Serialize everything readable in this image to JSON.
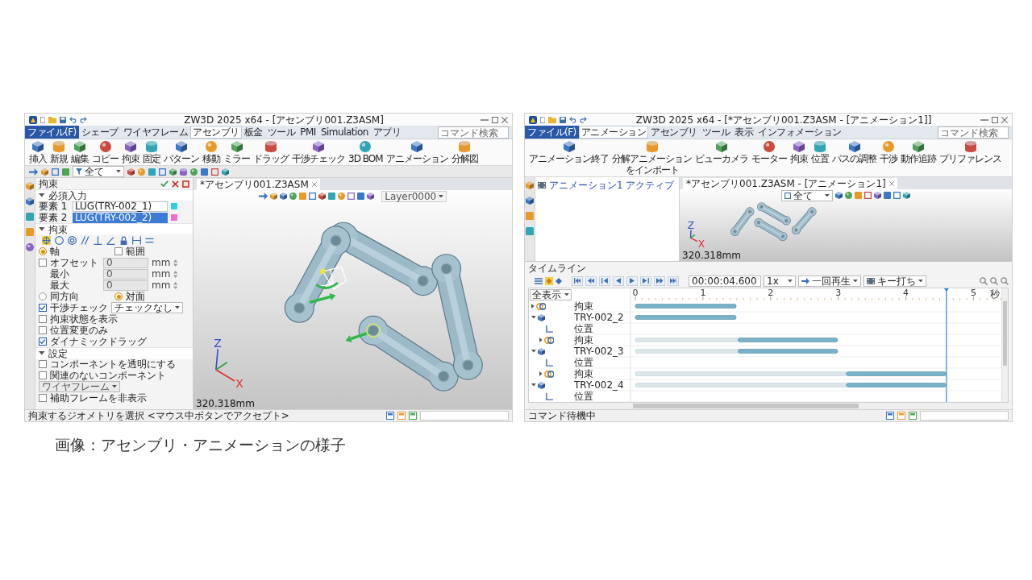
{
  "assembly_window": {
    "title_bar": {
      "title": "ZW3D 2025 x64 - [アセンブリ001.Z3ASM]"
    },
    "tabs": [
      {
        "label": "ファイル(F)",
        "kind": "file",
        "selected": false
      },
      {
        "label": "シェープ",
        "kind": "tab",
        "selected": false
      },
      {
        "label": "ワイヤフレーム",
        "kind": "tab",
        "selected": false
      },
      {
        "label": "アセンブリ",
        "kind": "tab",
        "selected": true
      },
      {
        "label": "板金",
        "kind": "tab",
        "selected": false
      },
      {
        "label": "ツール",
        "kind": "tab",
        "selected": false
      },
      {
        "label": "PMI",
        "kind": "tab",
        "selected": false
      },
      {
        "label": "Simulation",
        "kind": "tab",
        "selected": false
      },
      {
        "label": "アプリ",
        "kind": "tab",
        "selected": false
      }
    ],
    "search": {
      "placeholder": "コマンド検索"
    },
    "ribbon": [
      {
        "label": "挿入"
      },
      {
        "label": "新規"
      },
      {
        "label": "編集"
      },
      {
        "label": "コピー"
      },
      {
        "label": "拘束"
      },
      {
        "label": "固定"
      },
      {
        "label": "パターン"
      },
      {
        "label": "移動"
      },
      {
        "label": "ミラー"
      },
      {
        "label": "ドラッグ"
      },
      {
        "label": "干渉チェック"
      },
      {
        "label": "3D BOM"
      },
      {
        "label": "アニメーション"
      },
      {
        "label": "分解図"
      }
    ],
    "toolbar": {
      "filter": "全て"
    },
    "panel": {
      "title": "拘束",
      "sections": [
        {
          "title": "必須入力",
          "expanded": true,
          "rows": [
            {
              "kind": "field",
              "label": "要素 1",
              "value": "LUG(TRY-002_1)",
              "selected": false,
              "color": "#27d4e6"
            },
            {
              "kind": "field",
              "label": "要素 2",
              "value": "LUG(TRY-002_2)",
              "selected": true,
              "color": "#f06ccf"
            }
          ]
        },
        {
          "title": "拘束",
          "expanded": true,
          "rows": [
            {
              "kind": "icons",
              "items": [
                {
                  "selected": true
                },
                {
                  "selected": false
                },
                {
                  "selected": false
                },
                {
                  "selected": false
                },
                {
                  "selected": false
                },
                {
                  "selected": false
                },
                {
                  "selected": false
                },
                {
                  "selected": false
                },
                {
                  "selected": false
                }
              ]
            },
            {
              "kind": "options",
              "items": [
                {
                  "kind": "radio",
                  "label": "軸",
                  "selected": true
                },
                {
                  "kind": "check",
                  "label": "範囲",
                  "checked": false
                }
              ]
            },
            {
              "kind": "number",
              "label": "オフセット",
              "checked": false,
              "value": "0",
              "unit": "mm",
              "disabled": true
            },
            {
              "kind": "number",
              "label": "最小",
              "value": "0",
              "unit": "mm",
              "disabled": true
            },
            {
              "kind": "number",
              "label": "最大",
              "value": "0",
              "unit": "mm",
              "disabled": true
            },
            {
              "kind": "options",
              "items": [
                {
                  "kind": "radio",
                  "label": "同方向",
                  "selected": false
                },
                {
                  "kind": "radio",
                  "label": "対面",
                  "selected": true
                }
              ]
            },
            {
              "kind": "dropdown",
              "label": "干渉チェック",
              "checked": true,
              "value": "チェックなし",
              "disabled": false
            },
            {
              "kind": "check",
              "label": "拘束状態を表示",
              "checked": false
            },
            {
              "kind": "check",
              "label": "位置変更のみ",
              "checked": false
            },
            {
              "kind": "check",
              "label": "ダイナミックドラッグ",
              "checked": true
            }
          ]
        },
        {
          "title": "設定",
          "expanded": true,
          "rows": [
            {
              "kind": "check",
              "label": "コンポーネントを透明にする",
              "checked": false
            },
            {
              "kind": "dropdown",
              "label": "関連のないコンポーネント",
              "checked": false,
              "value": "ワイヤフレーム",
              "disabled": true
            },
            {
              "kind": "check",
              "label": "補助フレームを非表示",
              "checked": false
            }
          ]
        }
      ]
    },
    "document_tab": "*アセンブリ001.Z3ASM",
    "layer": "Layer0000",
    "axes": [
      "Z",
      "X"
    ],
    "scale": "320.318mm",
    "status_bar": "拘束するジオメトリを選択 <マウス中ボタンでアクセプト>"
  },
  "animation_window": {
    "title_bar": {
      "title": "ZW3D 2025 x64 - [*アセンブリ001.Z3ASM - [アニメーション1]]"
    },
    "tabs": [
      {
        "label": "ファイル(F)",
        "kind": "file",
        "selected": false
      },
      {
        "label": "アニメーション",
        "kind": "tab",
        "selected": true
      },
      {
        "label": "アセンブリ",
        "kind": "tab",
        "selected": false
      },
      {
        "label": "ツール",
        "kind": "tab",
        "selected": false
      },
      {
        "label": "表示",
        "kind": "tab",
        "selected": false
      },
      {
        "label": "インフォメーション",
        "kind": "tab",
        "selected": false
      }
    ],
    "search": {
      "placeholder": "コマンド検索"
    },
    "ribbon": [
      {
        "label": "アニメーション終了"
      },
      {
        "label": "分解アニメーションをインポート"
      },
      {
        "label": "ビューカメラ"
      },
      {
        "label": "モーター"
      },
      {
        "label": "拘束"
      },
      {
        "label": "位置"
      },
      {
        "label": "パスの調整"
      },
      {
        "label": "干渉"
      },
      {
        "label": "動作追跡"
      },
      {
        "label": "プリファレンス"
      }
    ],
    "manager": {
      "items": [
        {
          "label": "アニメーション1 アクティブ",
          "selected": false
        }
      ]
    },
    "document_tab": "*アセンブリ001.Z3ASM - [アニメーション1]",
    "view_filter": "全て",
    "axes": [
      "Z",
      "X"
    ],
    "scale": "320.318mm",
    "timeline": {
      "title": "タイムライン",
      "time": "00:00:04.600",
      "speed": "1x",
      "play_mode": "一回再生",
      "key_mode": "キー打ち",
      "filter": "全表示",
      "tree": [
        {
          "kind": "constraint",
          "expanded": false
        },
        {
          "kind": "component",
          "expanded": true,
          "children": [
            {
              "kind": "position"
            },
            {
              "kind": "constraint",
              "expanded": false
            }
          ]
        },
        {
          "kind": "component",
          "expanded": true,
          "children": [
            {
              "kind": "position"
            },
            {
              "kind": "constraint",
              "expanded": false
            }
          ]
        },
        {
          "kind": "component",
          "expanded": true,
          "children": [
            {
              "kind": "position"
            }
          ]
        }
      ],
      "chart_data": {
        "type": "bar",
        "orientation": "horizontal",
        "stacked": true,
        "categories": [
          "拘束",
          "TRY-002_2",
          "位置",
          "拘束",
          "TRY-002_3",
          "位置",
          "拘束",
          "TRY-002_4",
          "位置"
        ],
        "xlabel": "秒",
        "xlim": [
          0,
          5.4
        ],
        "xticks": [
          0,
          1,
          2,
          3,
          4,
          5
        ],
        "series": [
          {
            "color": "#dbe5ea",
            "values": [
              null,
              null,
              null,
              1.52,
              1.52,
              null,
              3.12,
              3.12,
              null
            ]
          },
          {
            "color": "#78b2c6",
            "values": [
              1.49,
              1.49,
              null,
              1.47,
              1.47,
              null,
              1.47,
              1.47,
              null
            ]
          }
        ],
        "ref_lines": [
          {
            "axis": "x",
            "value": 4.6
          }
        ]
      }
    },
    "status_bar": "コマンド待機中"
  },
  "caption": "画像：アセンブリ・アニメーションの様子"
}
